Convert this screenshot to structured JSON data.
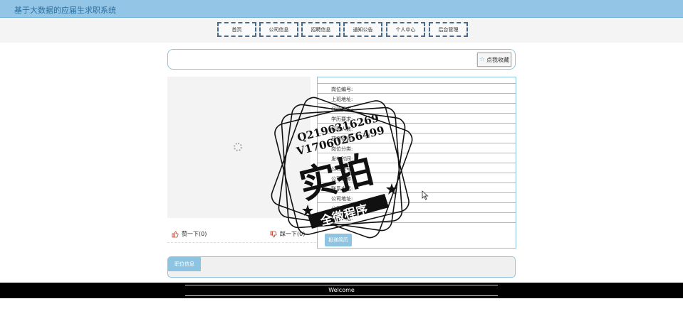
{
  "header": {
    "title": "基于大数据的应届生求职系统"
  },
  "nav": {
    "items": [
      {
        "label": "首页"
      },
      {
        "label": "公司信息"
      },
      {
        "label": "招聘信息"
      },
      {
        "label": "通知公告"
      },
      {
        "label": "个人中心"
      },
      {
        "label": "后台管理"
      }
    ]
  },
  "favorite": {
    "label": "点我收藏"
  },
  "vote": {
    "up_label": "赞一下(0)",
    "down_label": "踩一下(0)"
  },
  "detail": {
    "rows": [
      {
        "label": ""
      },
      {
        "label": "岗位编号:"
      },
      {
        "label": "上班地址:"
      },
      {
        "label": "经验要求:"
      },
      {
        "label": "学历要求:"
      },
      {
        "label": "招聘人数:"
      },
      {
        "label": "薪资待遇:"
      },
      {
        "label": "岗位分类:"
      },
      {
        "label": "发布时间:"
      },
      {
        "label": "公司账号:"
      },
      {
        "label": "公司名称:"
      },
      {
        "label": "联系电话:"
      },
      {
        "label": "公司地址:"
      },
      {
        "label": "公司类型:"
      },
      {
        "label": "岗位介绍:"
      }
    ],
    "apply_label": "投递简历"
  },
  "tabs": {
    "active_label": "职位信息"
  },
  "footer": {
    "text": "Welcome"
  },
  "watermark": {
    "line1": "Q2196316269",
    "line2": "V17060256499",
    "main": "实拍",
    "banner": "全微程序"
  },
  "colors": {
    "accent": "#8cc4e2",
    "header_bg": "#93c6e6",
    "footer_bg": "#000000"
  }
}
